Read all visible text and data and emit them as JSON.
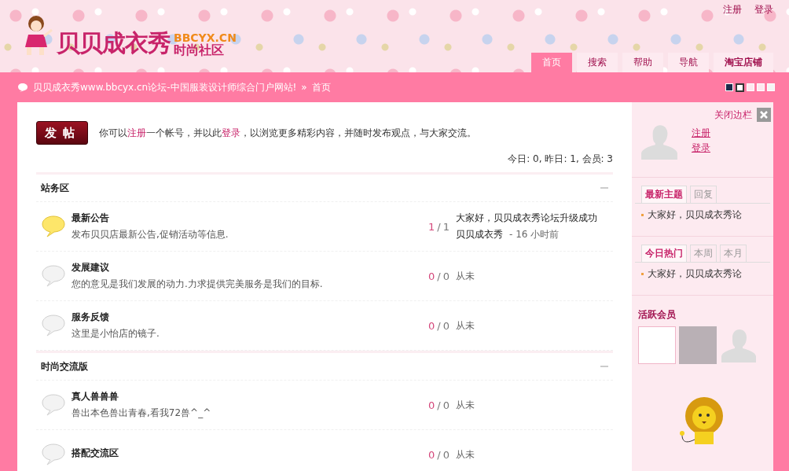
{
  "top_links": [
    "注册",
    "登录"
  ],
  "logo": {
    "name": "贝贝成衣秀",
    "domain": "BBCYX.CN",
    "tagline": "时尚社区"
  },
  "nav_tabs": [
    {
      "label": "首页",
      "selected": true
    },
    {
      "label": "搜索",
      "selected": false
    },
    {
      "label": "帮助",
      "selected": false
    },
    {
      "label": "导航",
      "selected": false
    },
    {
      "label": "淘宝店铺",
      "selected": false
    }
  ],
  "breadcrumb": {
    "site": "贝贝成衣秀www.bbcyx.cn论坛-中国服装设计师综合门户网站!",
    "separator": "»",
    "current": "首页"
  },
  "theme_swatches": [
    {
      "color": "#1c2b4b",
      "selected": false
    },
    {
      "color": "#ffffff",
      "selected": true
    },
    {
      "color": "#fde8ef",
      "selected": false
    },
    {
      "color": "#fde8ef",
      "selected": false
    },
    {
      "color": "#f4f4f4",
      "selected": false
    }
  ],
  "post_button": "发帖",
  "intro": [
    {
      "text": "你可以",
      "kind": "text"
    },
    {
      "text": "注册",
      "kind": "link"
    },
    {
      "text": "一个帐号，并以此",
      "kind": "text"
    },
    {
      "text": "登录",
      "kind": "link"
    },
    {
      "text": "，以浏览更多精彩内容，并随时发布观点，与大家交流。",
      "kind": "text"
    }
  ],
  "stats": "今日: 0, 昨日: 1, 会员: 3",
  "sections": [
    {
      "title": "站务区",
      "forums": [
        {
          "name": "最新公告",
          "description": "发布贝贝店最新公告,促销活动等信息.",
          "has_new": true,
          "topics": "1",
          "separator": "/",
          "posts": "1",
          "last_post": {
            "title": "大家好，贝贝成衣秀论坛升级成功",
            "author": "贝贝成衣秀",
            "time": "- 16 小时前"
          }
        },
        {
          "name": "发展建议",
          "description": "您的意见是我们发展的动力.力求提供完美服务是我们的目标.",
          "has_new": false,
          "topics": "0",
          "separator": "/",
          "posts": "0",
          "last_post_text": "从未"
        },
        {
          "name": "服务反馈",
          "description": "这里是小怡店的镜子.",
          "has_new": false,
          "topics": "0",
          "separator": "/",
          "posts": "0",
          "last_post_text": "从未"
        }
      ]
    },
    {
      "title": "时尚交流版",
      "forums": [
        {
          "name": "真人兽兽兽",
          "description": "兽出本色兽出青春,看我72兽^_^",
          "has_new": false,
          "topics": "0",
          "separator": "/",
          "posts": "0",
          "last_post_text": "从未"
        },
        {
          "name": "搭配交流区",
          "has_new": false,
          "topics": "0",
          "separator": "/",
          "posts": "0",
          "last_post_text": "从未"
        }
      ]
    }
  ],
  "sidebar": {
    "close_label": "关闭边栏",
    "user_links": [
      "注册",
      "登录"
    ],
    "tab_groups": [
      {
        "tabs": [
          {
            "label": "最新主题",
            "selected": true
          },
          {
            "label": "回复",
            "selected": false
          }
        ],
        "items": [
          "大家好，贝贝成衣秀论"
        ]
      },
      {
        "tabs": [
          {
            "label": "今日热门",
            "selected": true
          },
          {
            "label": "本周",
            "selected": false
          },
          {
            "label": "本月",
            "selected": false
          }
        ],
        "items": [
          "大家好，贝贝成衣秀论"
        ]
      }
    ],
    "active_members": {
      "title": "活跃会员",
      "members": [
        {
          "kind": "logo"
        },
        {
          "kind": "photo"
        },
        {
          "kind": "silhouette"
        }
      ]
    }
  }
}
